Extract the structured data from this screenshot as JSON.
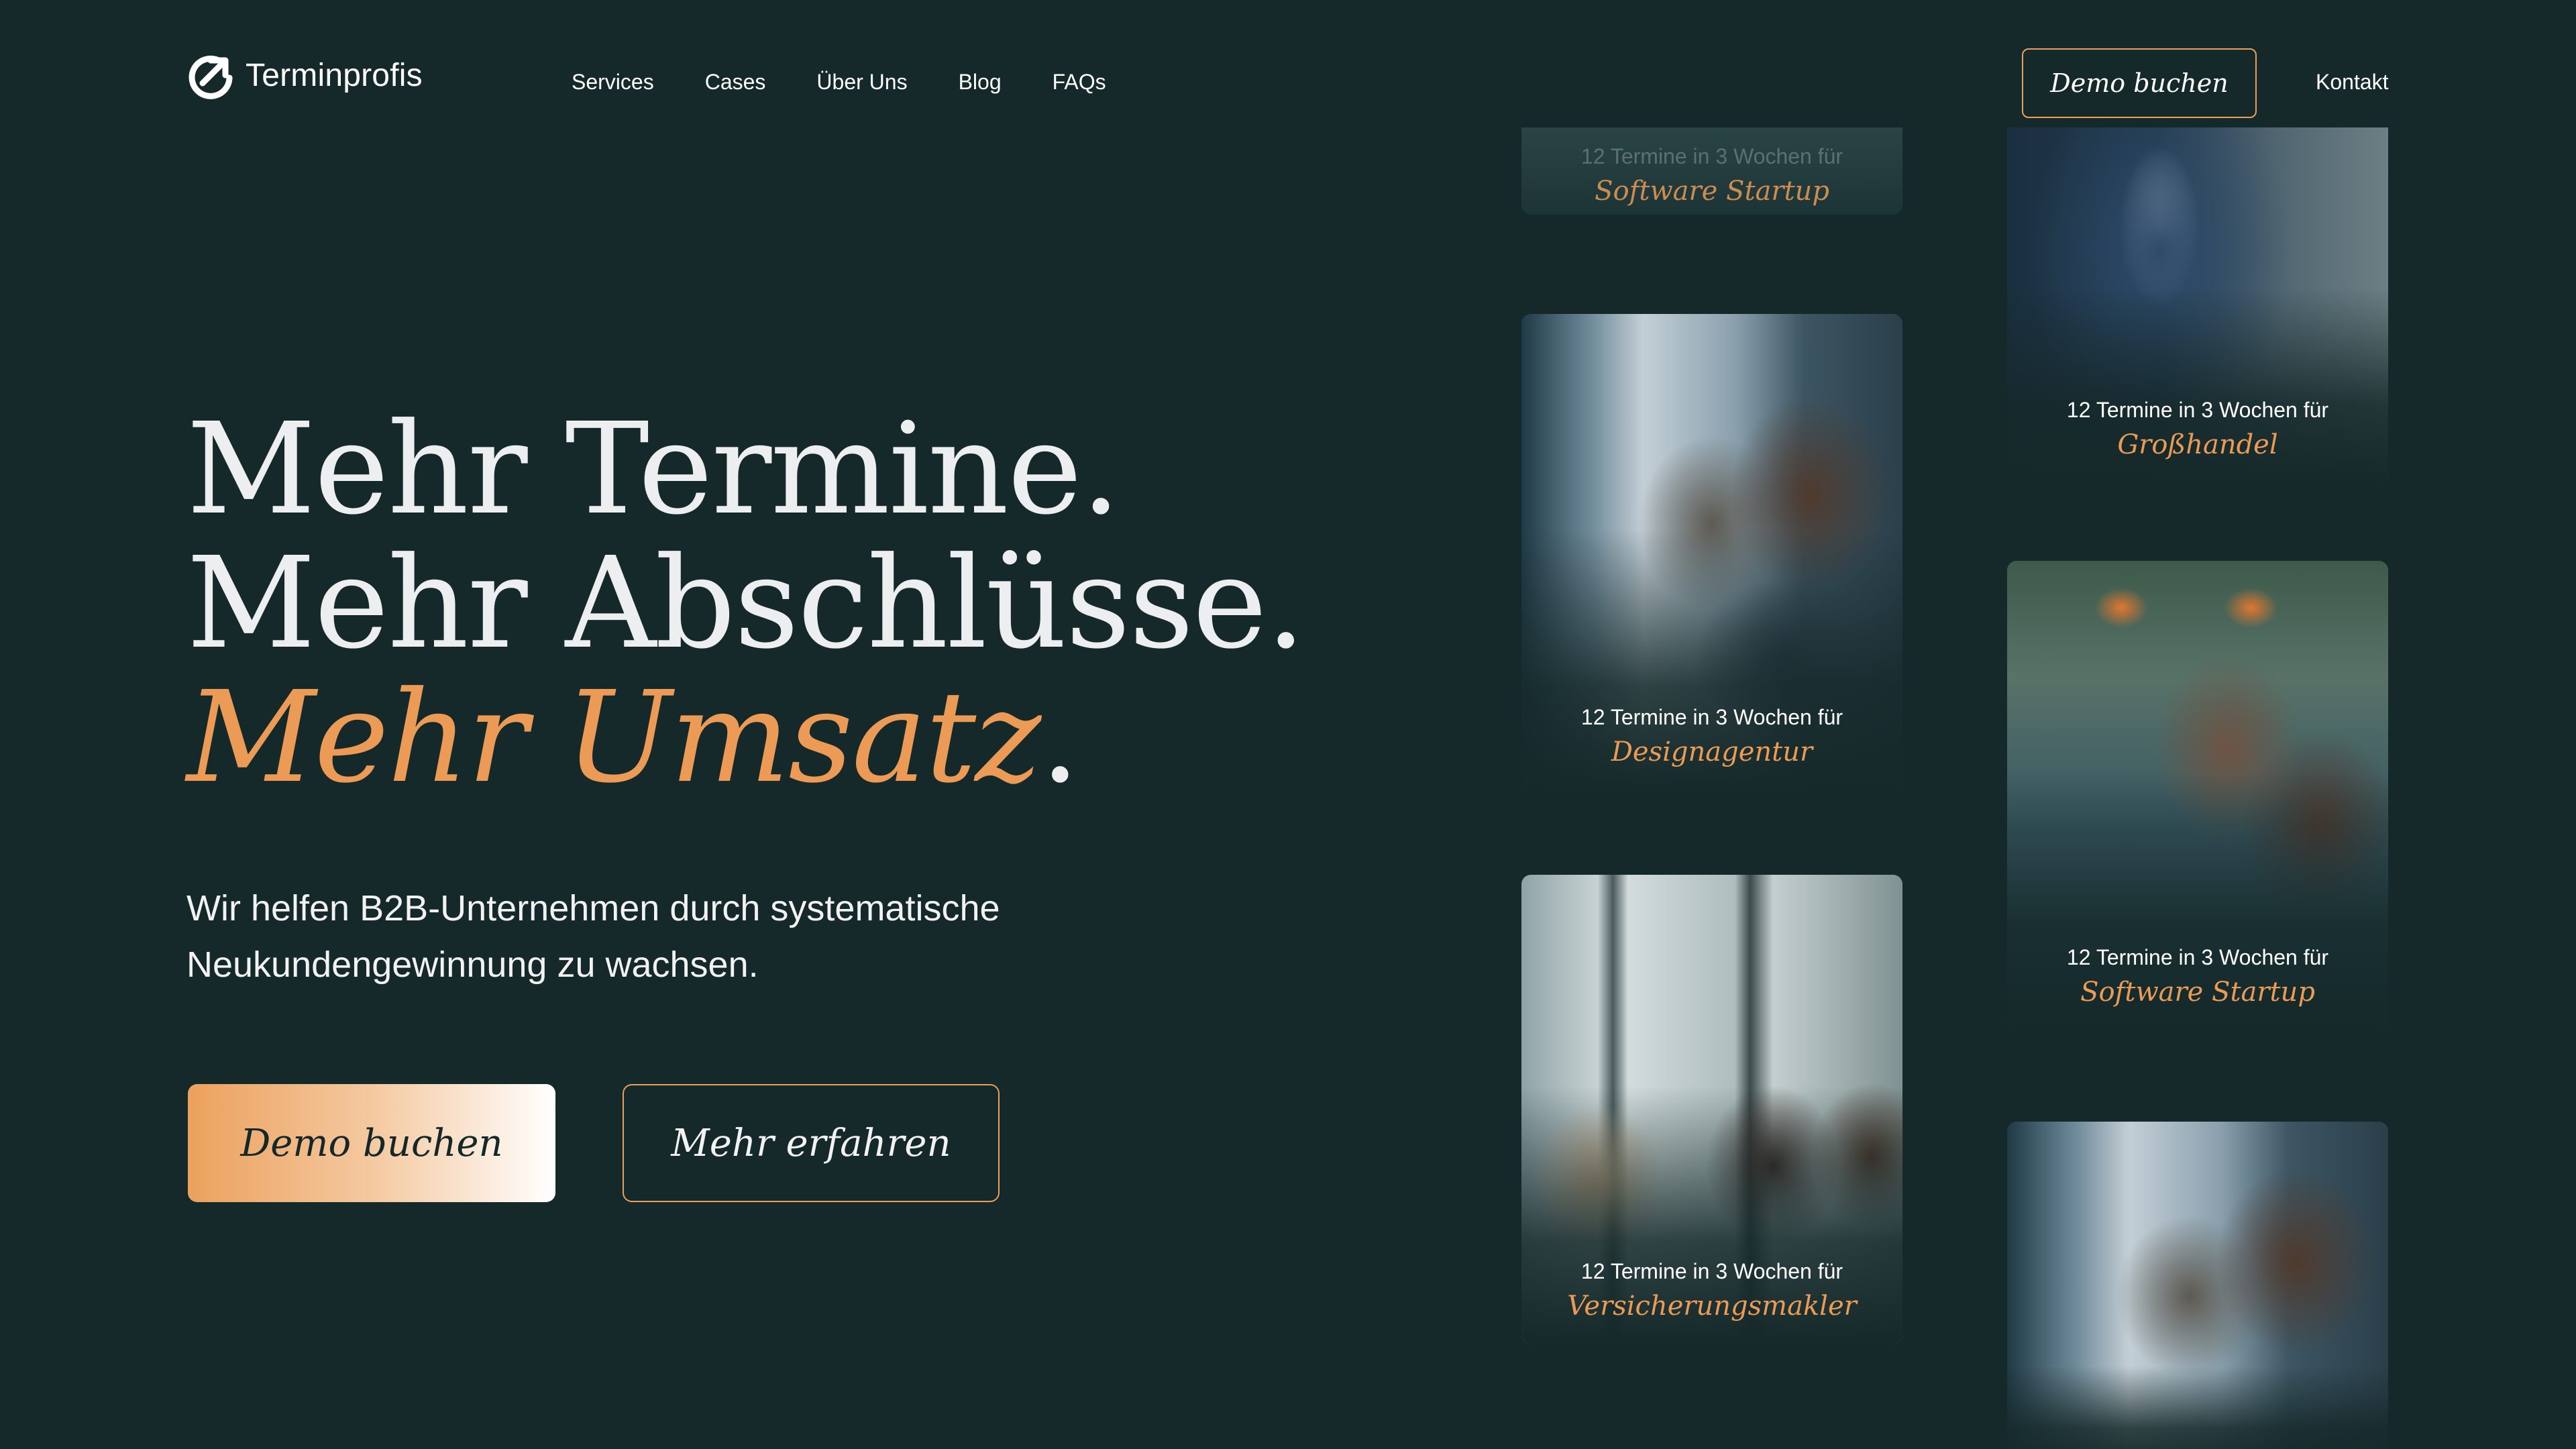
{
  "brand": {
    "name": "Terminprofis",
    "logo_icon": "arrow-circle-logo-icon",
    "accent": "#eb9b55",
    "background": "#15292a"
  },
  "nav": {
    "items": [
      {
        "label": "Services"
      },
      {
        "label": "Cases"
      },
      {
        "label": "Über Uns"
      },
      {
        "label": "Blog"
      },
      {
        "label": "FAQs"
      }
    ],
    "demo_label": "Demo buchen",
    "contact_label": "Kontakt"
  },
  "hero": {
    "line1": "Mehr Termine.",
    "line2": "Mehr Abschlüsse.",
    "line3_accent": "Mehr Umsatz",
    "line3_dot": ".",
    "subtext": "Wir helfen B2B-Unternehmen durch systematische Neukundengewinnung zu wachsen.",
    "primary_cta": "Demo buchen",
    "secondary_cta": "Mehr erfahren"
  },
  "cases": [
    {
      "caption": "12 Termine in 3 Wochen für",
      "industry": "Software Startup"
    },
    {
      "caption": "12 Termine in 3 Wochen für",
      "industry": "Designagentur"
    },
    {
      "caption": "12 Termine in 3 Wochen für",
      "industry": "Versicherungsmakler"
    },
    {
      "caption": "12 Termine in 3 Wochen für",
      "industry": "Großhandel"
    },
    {
      "caption": "12 Termine in 3 Wochen für",
      "industry": "Software Startup"
    },
    {
      "caption": "",
      "industry": ""
    }
  ]
}
